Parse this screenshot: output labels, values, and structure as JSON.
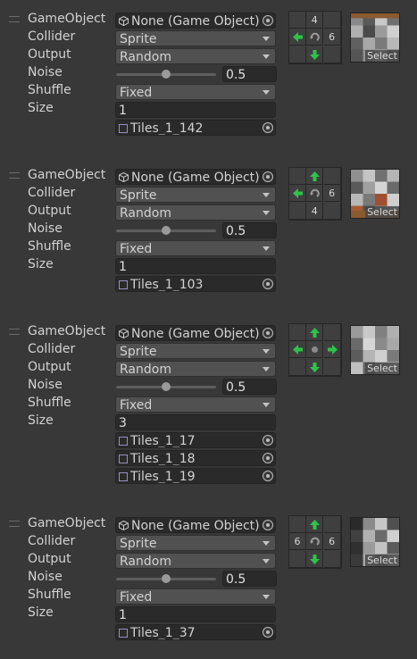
{
  "labels": {
    "gameobject": "GameObject",
    "collider": "Collider",
    "output": "Output",
    "noise": "Noise",
    "shuffle": "Shuffle",
    "size": "Size"
  },
  "select_label": "Select",
  "icons": {
    "object_field": "cube-icon",
    "sprite_field": "sprite-icon",
    "picker": "object-picker-icon",
    "arrow": "green-arrow-icon",
    "rotate": "rotate-icon"
  },
  "colors": {
    "arrow_green": "#2fc24a",
    "background": "#383838"
  },
  "rules": [
    {
      "gameobject": "None (Game Object)",
      "collider": "Sprite",
      "output": "Random",
      "noise_value": "0.5",
      "noise_level": 0.5,
      "shuffle": "Fixed",
      "size": "1",
      "sprites": [
        "Tiles_1_142"
      ],
      "neighbors": {
        "tl": "",
        "t": "4",
        "tr": "",
        "l": "left-arrow",
        "c": "rotate-icon",
        "r": "6",
        "bl": "",
        "b": "down-arrow",
        "br": ""
      }
    },
    {
      "gameobject": "None (Game Object)",
      "collider": "Sprite",
      "output": "Random",
      "noise_value": "0.5",
      "noise_level": 0.5,
      "shuffle": "Fixed",
      "size": "1",
      "sprites": [
        "Tiles_1_103"
      ],
      "neighbors": {
        "tl": "",
        "t": "up-arrow",
        "tr": "",
        "l": "left-arrow",
        "c": "rotate-icon",
        "r": "6",
        "bl": "",
        "b": "4",
        "br": ""
      }
    },
    {
      "gameobject": "None (Game Object)",
      "collider": "Sprite",
      "output": "Random",
      "noise_value": "0.5",
      "noise_level": 0.5,
      "shuffle": "Fixed",
      "size": "3",
      "sprites": [
        "Tiles_1_17",
        "Tiles_1_18",
        "Tiles_1_19"
      ],
      "neighbors": {
        "tl": "",
        "t": "up-arrow",
        "tr": "",
        "l": "left-arrow",
        "c": "dot",
        "r": "right-arrow",
        "bl": "",
        "b": "down-arrow",
        "br": ""
      }
    },
    {
      "gameobject": "None (Game Object)",
      "collider": "Sprite",
      "output": "Random",
      "noise_value": "0.5",
      "noise_level": 0.5,
      "shuffle": "Fixed",
      "size": "1",
      "sprites": [
        "Tiles_1_37"
      ],
      "neighbors": {
        "tl": "",
        "t": "up-arrow",
        "tr": "",
        "l": "6",
        "c": "rotate-icon",
        "r": "6",
        "bl": "",
        "b": "down-arrow",
        "br": ""
      }
    }
  ]
}
